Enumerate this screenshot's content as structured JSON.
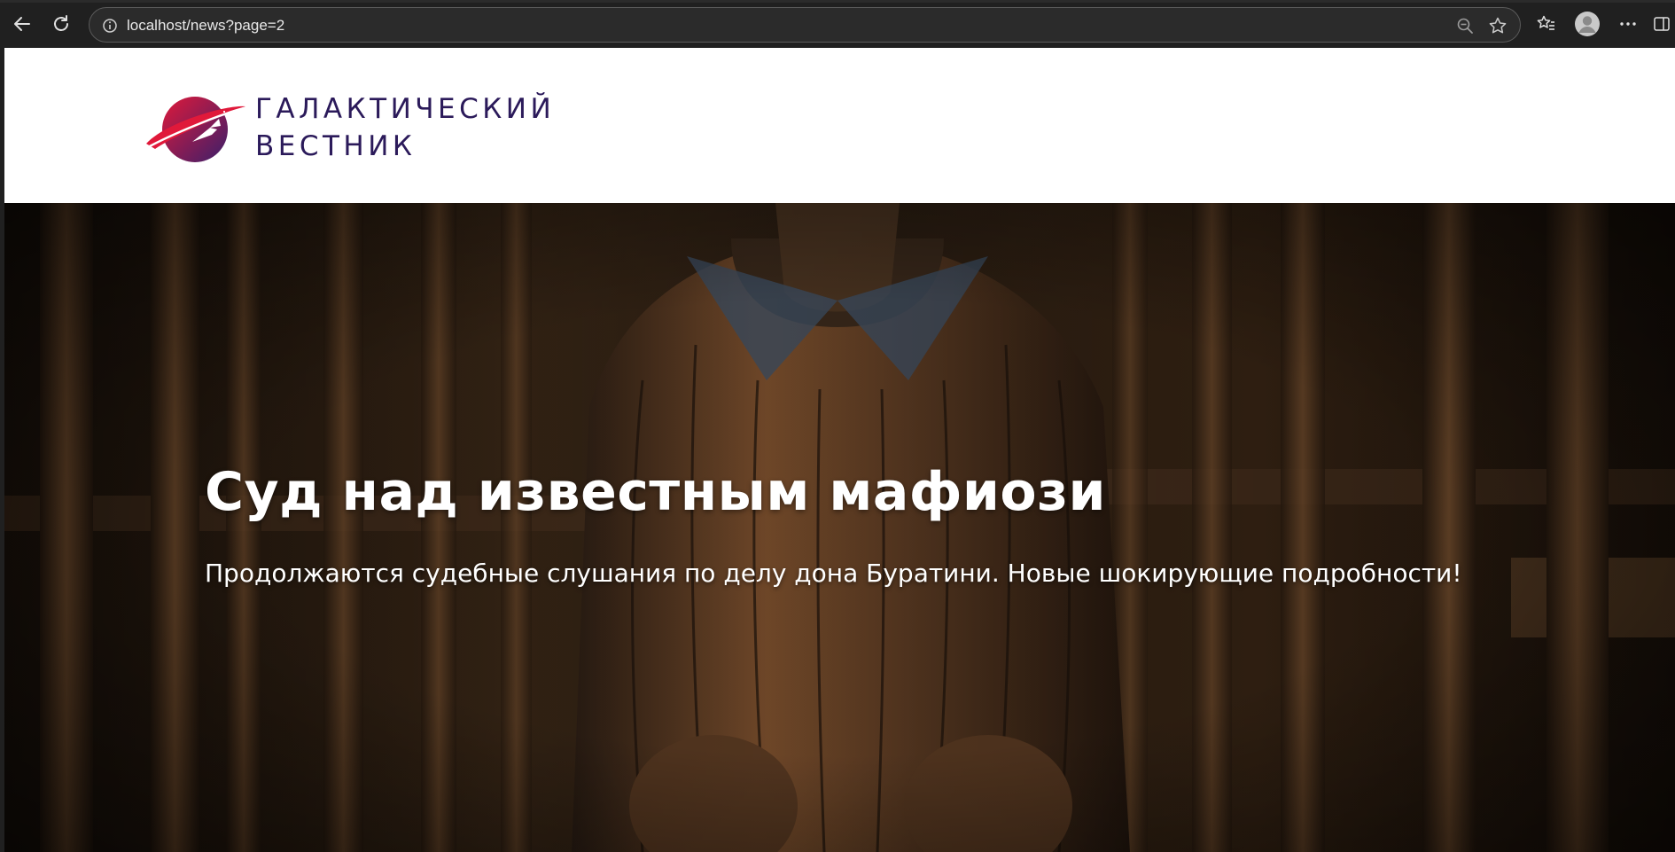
{
  "browser": {
    "url": "localhost/news?page=2",
    "icons": {
      "back": "back-arrow-icon",
      "reload": "reload-icon",
      "site_info": "info-icon",
      "zoom": "zoom-out-icon",
      "favorite": "star-icon",
      "favorites": "favorites-icon",
      "profile": "profile-avatar-icon",
      "more": "more-dots-icon",
      "sidebar": "sidebar-icon"
    }
  },
  "site": {
    "logo_line1": "ГАЛАКТИЧЕСКИЙ",
    "logo_line2": "ВЕСТНИК",
    "brand_colors": {
      "text": "#2b1a5a",
      "planet_start": "#e0193a",
      "planet_end": "#3a1f6b"
    }
  },
  "hero": {
    "title": "Суд над известным мафиози",
    "subtitle": "Продолжаются судебные слушания по делу дона Буратини. Новые шокирующие подробности!"
  }
}
